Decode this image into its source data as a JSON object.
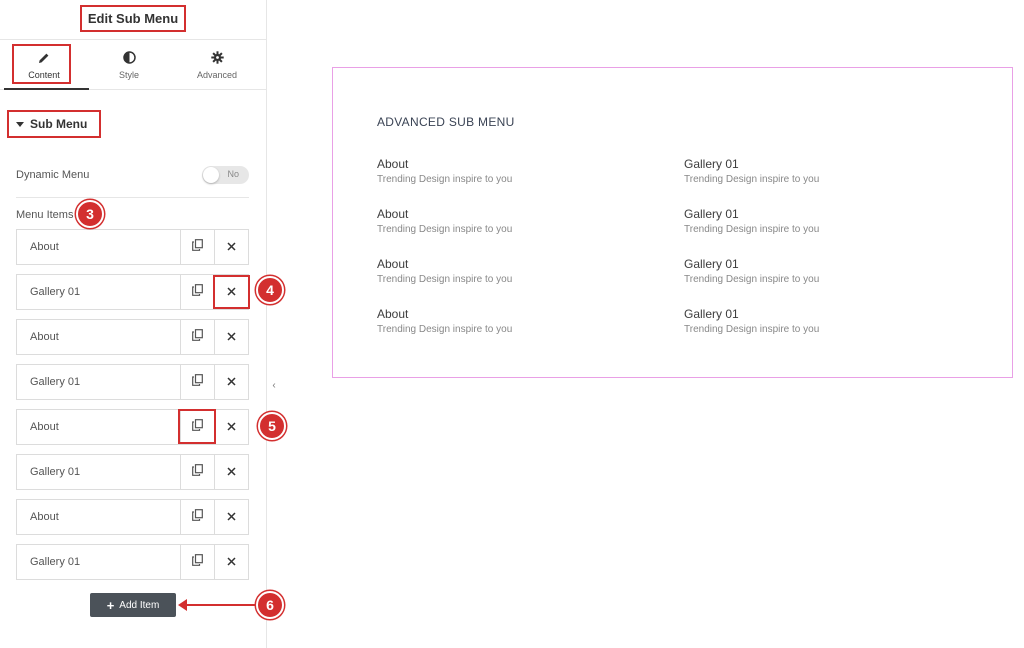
{
  "panel": {
    "title": "Edit Sub Menu",
    "tabs": [
      {
        "label": "Content",
        "icon": "pencil-icon"
      },
      {
        "label": "Style",
        "icon": "half-circle-icon"
      },
      {
        "label": "Advanced",
        "icon": "gear-icon"
      }
    ],
    "section_title": "Sub Menu",
    "dynamic_menu": {
      "label": "Dynamic Menu",
      "toggle_text": "No"
    },
    "menu_items_label": "Menu Items",
    "items": [
      {
        "label": "About"
      },
      {
        "label": "Gallery 01"
      },
      {
        "label": "About"
      },
      {
        "label": "Gallery 01"
      },
      {
        "label": "About"
      },
      {
        "label": "Gallery 01"
      },
      {
        "label": "About"
      },
      {
        "label": "Gallery 01"
      }
    ],
    "add_item_label": "Add Item"
  },
  "callouts": {
    "c3": "3",
    "c4": "4",
    "c5": "5",
    "c6": "6"
  },
  "preview": {
    "title": "ADVANCED SUB MENU",
    "left": [
      {
        "title": "About",
        "subtitle": "Trending Design inspire to you"
      },
      {
        "title": "About",
        "subtitle": "Trending Design inspire to you"
      },
      {
        "title": "About",
        "subtitle": "Trending Design inspire to you"
      },
      {
        "title": "About",
        "subtitle": "Trending Design inspire to you"
      }
    ],
    "right": [
      {
        "title": "Gallery 01",
        "subtitle": "Trending Design inspire to you"
      },
      {
        "title": "Gallery 01",
        "subtitle": "Trending Design inspire to you"
      },
      {
        "title": "Gallery 01",
        "subtitle": "Trending Design inspire to you"
      },
      {
        "title": "Gallery 01",
        "subtitle": "Trending Design inspire to you"
      }
    ]
  },
  "colors": {
    "accent": "#d32f2f",
    "preview_border": "#e9a0e6",
    "button_bg": "#4b5259"
  }
}
